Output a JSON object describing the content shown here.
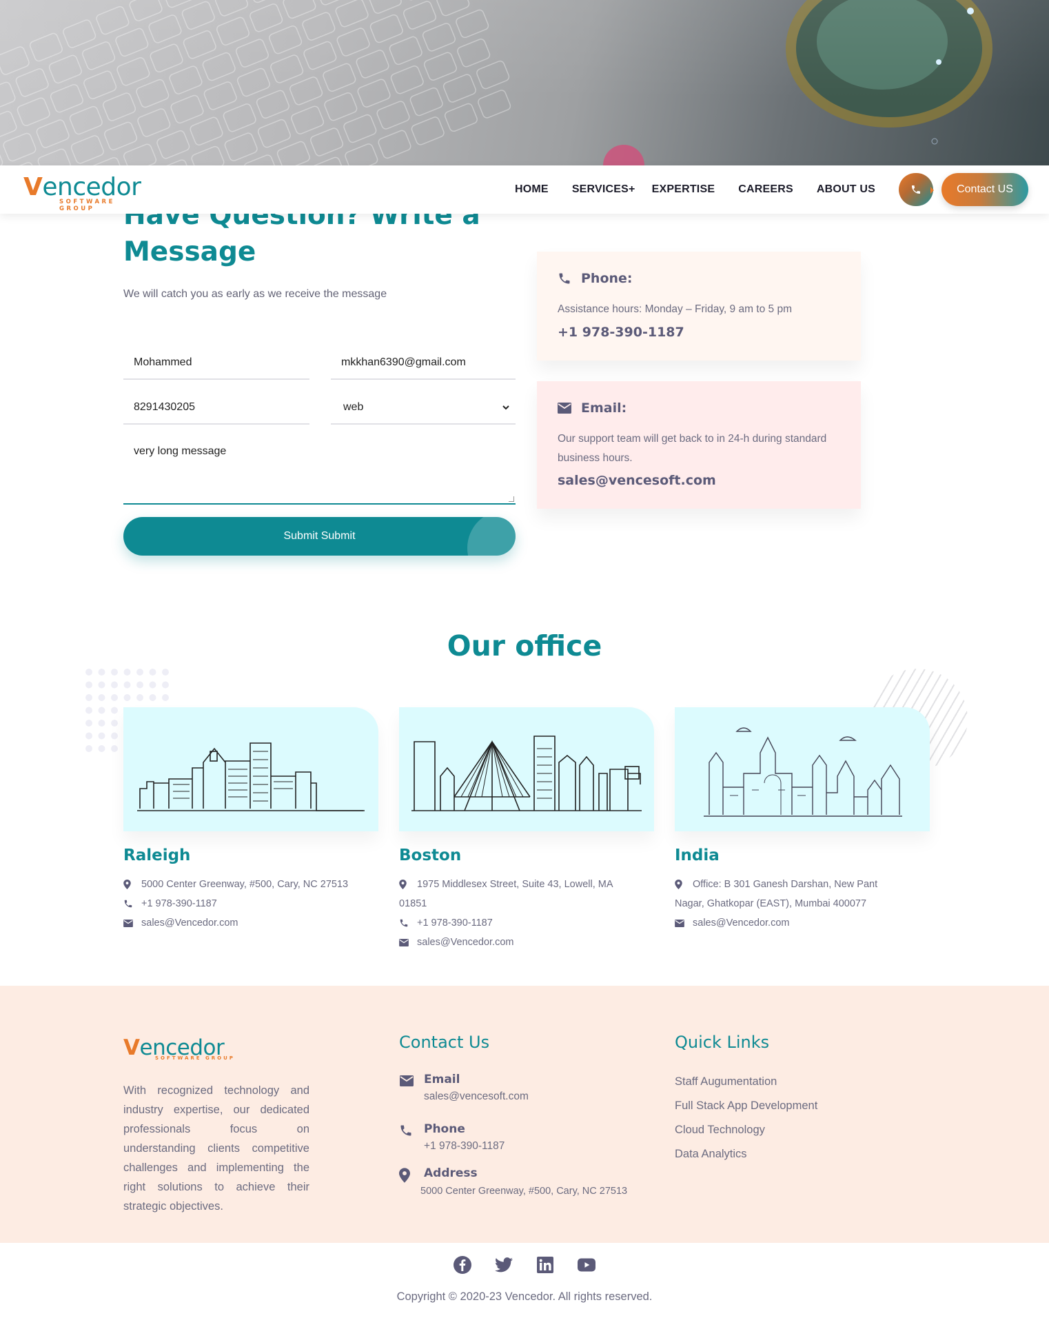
{
  "nav": {
    "logo_main": "encedor",
    "logo_v": "V",
    "logo_sub": "SOFTWARE GROUP",
    "items": [
      "HOME",
      "SERVICES+",
      "EXPERTISE",
      "CAREERS",
      "ABOUT US"
    ],
    "contact_label": "Contact US"
  },
  "form": {
    "title": "Have Question? Write a Message",
    "subtitle": "We will catch you as early as we receive the message",
    "name_value": "Mohammed",
    "email_value": "mkkhan6390@gmail.com",
    "phone_value": "8291430205",
    "service_value": "web",
    "message_value": "very long message",
    "submit_label": "Submit Submit"
  },
  "info_cards": {
    "phone": {
      "title": "Phone:",
      "desc": "Assistance hours: Monday – Friday, 9 am to 5 pm",
      "value": "+1 978-390-1187"
    },
    "email": {
      "title": "Email:",
      "desc": "Our support team will get back to in 24-h during standard business hours.",
      "value": "sales@vencesoft.com"
    }
  },
  "offices": {
    "title": "Our office",
    "items": [
      {
        "city": "Raleigh",
        "address": "5000 Center Greenway, #500, Cary, NC 27513",
        "phone": "+1 978-390-1187",
        "email": "sales@Vencedor.com"
      },
      {
        "city": "Boston",
        "address": "1975 Middlesex Street, Suite 43, Lowell, MA 01851",
        "phone": "+1 978-390-1187",
        "email": "sales@Vencedor.com"
      },
      {
        "city": "India",
        "address": "Office: B 301 Ganesh Darshan, New Pant Nagar, Ghatkopar (EAST), Mumbai 400077",
        "email": "sales@Vencedor.com"
      }
    ]
  },
  "footer": {
    "about": "With recognized technology and industry expertise, our dedicated professionals focus on understanding clients competitive challenges and implementing the right solutions to achieve their strategic objectives.",
    "contact_title": "Contact Us",
    "email_label": "Email",
    "email_value": "sales@vencesoft.com",
    "phone_label": "Phone",
    "phone_value": "+1 978-390-1187",
    "address_label": "Address",
    "address_value": "5000 Center Greenway, #500, Cary, NC 27513",
    "links_title": "Quick Links",
    "links": [
      "Staff Augumentation",
      "Full Stack App Development",
      "Cloud Technology",
      "Data Analytics"
    ],
    "social": [
      "facebook-icon",
      "twitter-icon",
      "linkedin-icon",
      "youtube-icon"
    ],
    "copyright": "Copyright © 2020-23 Vencedor. All rights reserved."
  },
  "colors": {
    "primary": "#0e8a93",
    "accent": "#e87a2a",
    "text": "#5b5a78"
  }
}
